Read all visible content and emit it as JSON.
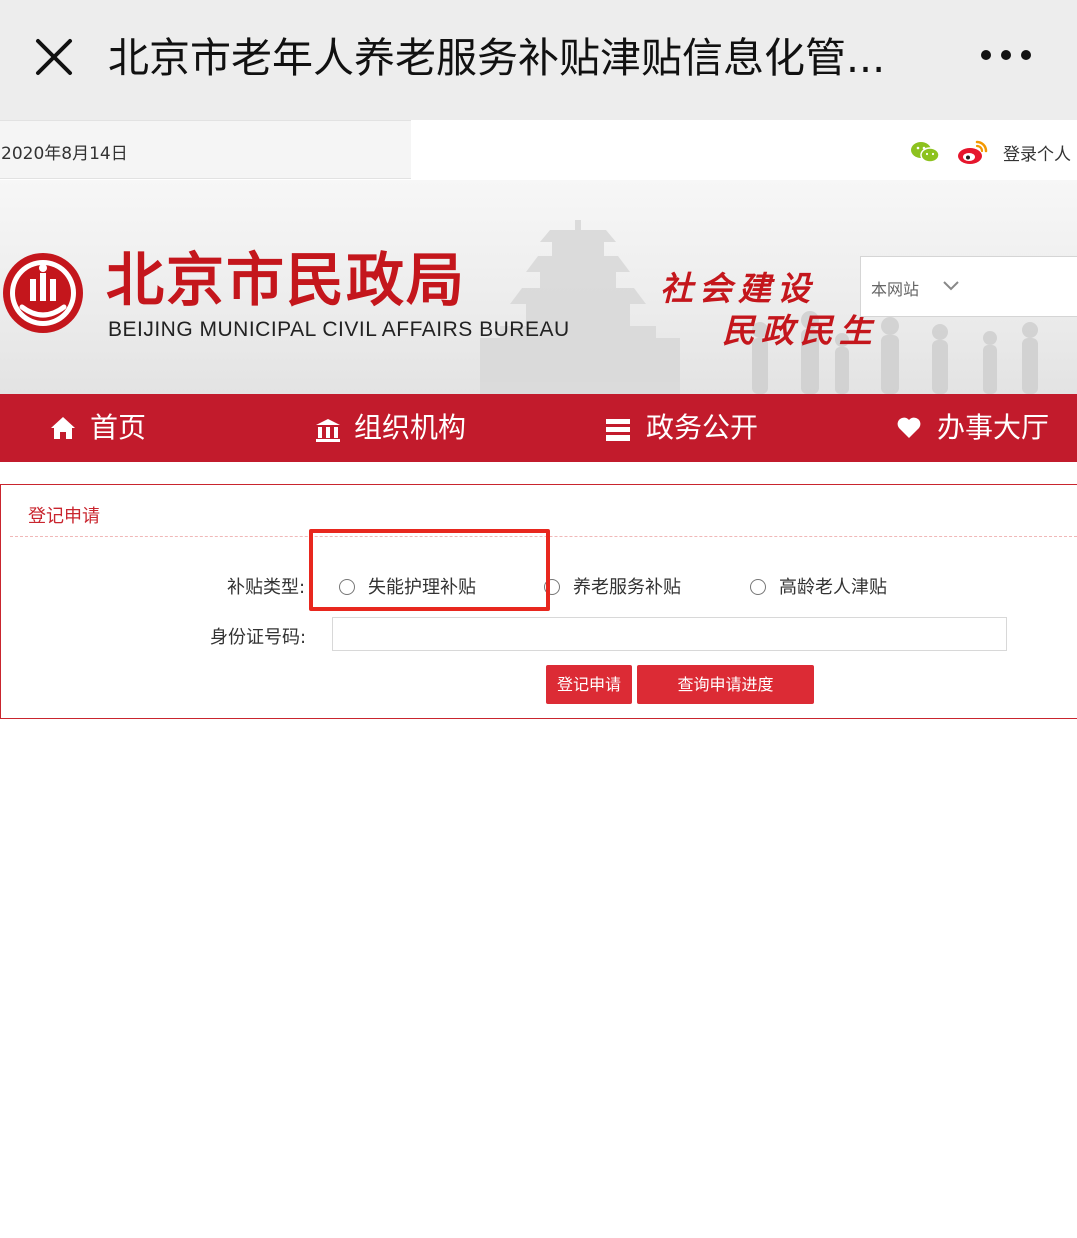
{
  "appbar": {
    "title": "北京市老年人养老服务补贴津贴信息化管..."
  },
  "topbar": {
    "date": "2020年8月14日",
    "login_text": "登录个人"
  },
  "header": {
    "bureau_name_cn": "北京市民政局",
    "bureau_name_en": "BEIJING MUNICIPAL CIVIL AFFAIRS BUREAU",
    "slogan_line1": "社会建设",
    "slogan_line2": "民政民生",
    "search_scope": "本网站"
  },
  "nav": {
    "items": [
      {
        "label": "首页",
        "icon": "home-icon"
      },
      {
        "label": "组织机构",
        "icon": "institution-icon"
      },
      {
        "label": "政务公开",
        "icon": "document-stack-icon"
      },
      {
        "label": "办事大厅",
        "icon": "heart-icon"
      }
    ]
  },
  "form": {
    "title": "登记申请",
    "subsidy_type_label": "补贴类型:",
    "options": [
      {
        "label": "失能护理补贴",
        "selected": false,
        "highlighted": true
      },
      {
        "label": "养老服务补贴",
        "selected": false
      },
      {
        "label": "高龄老人津贴",
        "selected": false
      }
    ],
    "id_label": "身份证号码:",
    "id_value": "",
    "register_button": "登记申请",
    "query_button": "查询申请进度"
  },
  "colors": {
    "brand_red": "#c21b2c",
    "button_red": "#dc2b35",
    "highlight_red": "#e8271e",
    "appbar_gray": "#ededed"
  }
}
